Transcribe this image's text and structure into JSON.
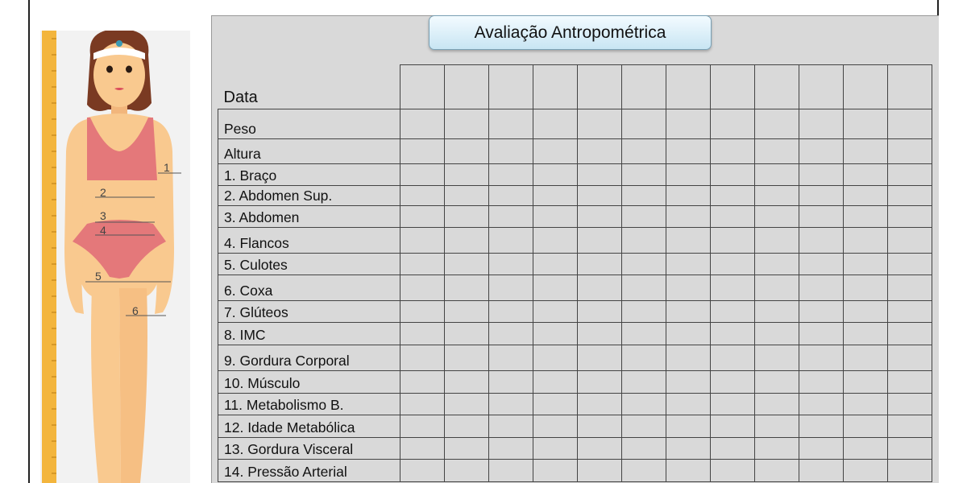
{
  "title": "Avaliação Antropométrica",
  "header_label": "Data",
  "column_count": 12,
  "rows": [
    {
      "label": "Peso",
      "height": 37
    },
    {
      "label": "Altura",
      "height": 31
    },
    {
      "label": "1. Braço",
      "height": 27
    },
    {
      "label": "2. Abdomen Sup.",
      "height": 25
    },
    {
      "label": "3. Abdomen",
      "height": 27
    },
    {
      "label": "4. Flancos",
      "height": 32
    },
    {
      "label": "5. Culotes",
      "height": 27
    },
    {
      "label": "6. Coxa",
      "height": 32
    },
    {
      "label": "7. Glúteos",
      "height": 27
    },
    {
      "label": "8. IMC",
      "height": 28
    },
    {
      "label": "9. Gordura Corporal",
      "height": 32
    },
    {
      "label": "10. Músculo",
      "height": 28
    },
    {
      "label": "11. Metabolismo B.",
      "height": 27
    },
    {
      "label": "12. Idade Metabólica",
      "height": 28
    },
    {
      "label": "13. Gordura Visceral",
      "height": 27
    },
    {
      "label": "14. Pressão Arterial",
      "height": 28
    }
  ],
  "figure": {
    "markers": [
      "1",
      "2",
      "3",
      "4",
      "5",
      "6"
    ]
  },
  "colors": {
    "skin": "#f9c98f",
    "underwear": "#e4787a",
    "hair": "#7a3a22",
    "ruler": "#f3b53d",
    "badge": "#c8e5f3"
  }
}
